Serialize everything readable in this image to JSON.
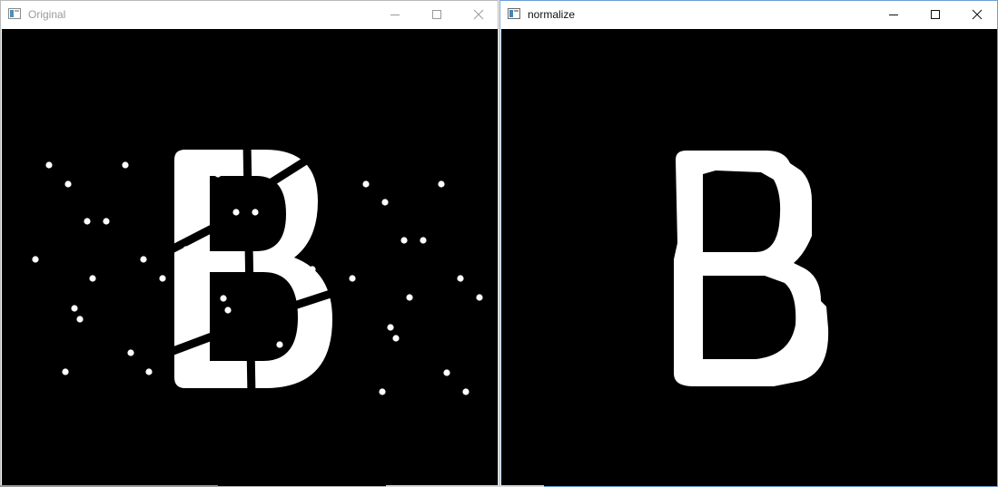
{
  "windows": {
    "original": {
      "title": "Original",
      "icon": "app-window-icon"
    },
    "normalize": {
      "title": "normalize",
      "icon": "app-window-icon"
    }
  },
  "caption_buttons": [
    "minimize-icon",
    "maximize-icon",
    "close-icon"
  ],
  "colors": {
    "canvas_background": "#000000",
    "foreground": "#ffffff",
    "inactive_title": "#9a9a9a",
    "active_title": "#111111",
    "active_border": "#6e9fd6"
  }
}
